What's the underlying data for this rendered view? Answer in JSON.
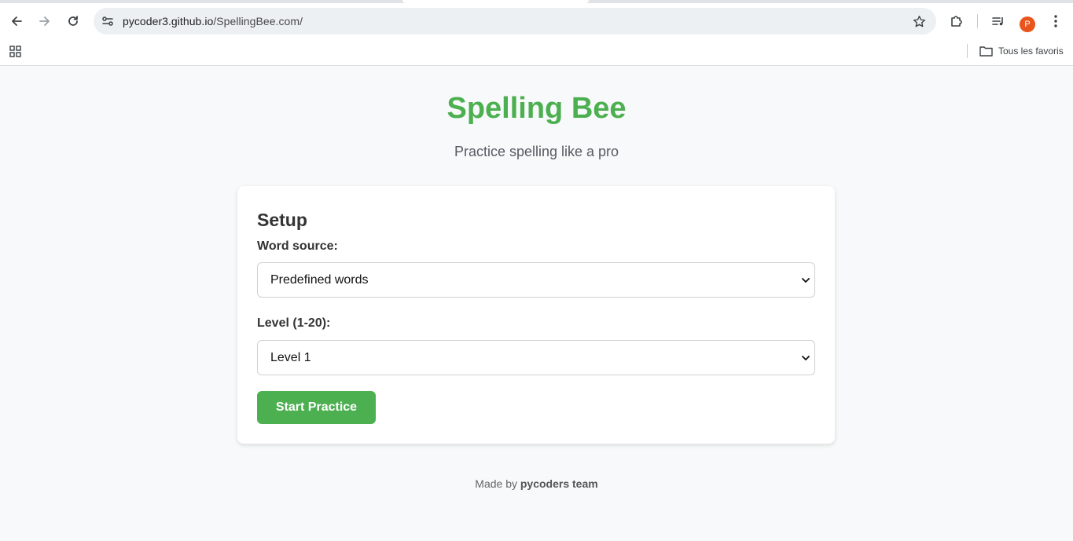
{
  "browser": {
    "url_host": "pycoder3.github.io",
    "url_path": "/SpellingBee.com/",
    "profile_initial": "P",
    "bookmarks_folder_label": "Tous les favoris"
  },
  "app": {
    "title": "Spelling Bee",
    "subtitle": "Practice spelling like a pro"
  },
  "setup": {
    "heading": "Setup",
    "word_source_label": "Word source:",
    "word_source_value": "Predefined words",
    "level_label": "Level (1-20):",
    "level_value": "Level 1",
    "start_button": "Start Practice"
  },
  "footer": {
    "made_by": "Made by",
    "team": "pycoders team"
  },
  "colors": {
    "accent": "#4caf50",
    "avatar": "#e8541c"
  },
  "icons": [
    "back-icon",
    "forward-icon",
    "reload-icon",
    "site-info-icon",
    "star-icon",
    "extensions-icon",
    "media-control-icon",
    "kebab-menu-icon",
    "apps-grid-icon",
    "folder-icon",
    "chevron-down-icon"
  ]
}
